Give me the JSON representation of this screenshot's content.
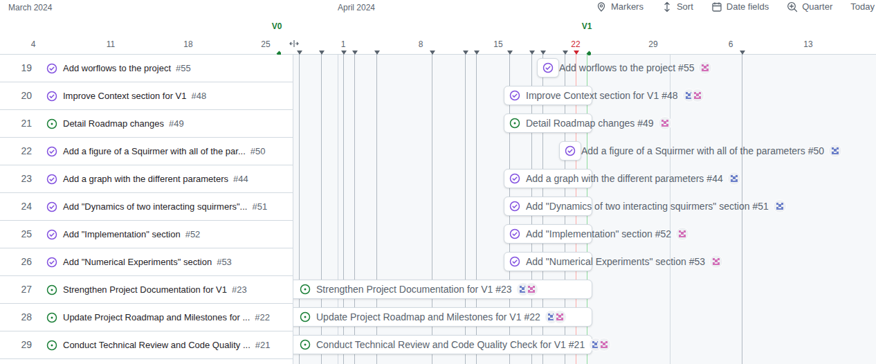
{
  "header": {
    "months": [
      {
        "label": "March 2024",
        "start": "2024-03-01"
      },
      {
        "label": "April 2024",
        "start": "2024-04-01"
      }
    ],
    "controls": [
      {
        "label": "Markers",
        "kind": "marker"
      },
      {
        "label": "Sort",
        "kind": "sort"
      },
      {
        "label": "Date fields",
        "kind": "calendar"
      },
      {
        "label": "Quarter",
        "kind": "zoom"
      },
      {
        "label": "Today",
        "kind": "none"
      }
    ],
    "ticks": [
      {
        "label": "4",
        "date": "2024-03-04",
        "today": false
      },
      {
        "label": "11",
        "date": "2024-03-11",
        "today": false
      },
      {
        "label": "18",
        "date": "2024-03-18",
        "today": false
      },
      {
        "label": "25",
        "date": "2024-03-25",
        "today": false
      },
      {
        "label": "1",
        "date": "2024-04-01",
        "today": false
      },
      {
        "label": "8",
        "date": "2024-04-08",
        "today": false
      },
      {
        "label": "15",
        "date": "2024-04-15",
        "today": false
      },
      {
        "label": "22",
        "date": "2024-04-22",
        "today": true
      },
      {
        "label": "29",
        "date": "2024-04-29",
        "today": false
      },
      {
        "label": "6",
        "date": "2024-05-06",
        "today": false
      },
      {
        "label": "13",
        "date": "2024-05-13",
        "today": false
      }
    ]
  },
  "markers": [
    {
      "date": "2024-03-26",
      "kind": "milestone",
      "label": "V0"
    },
    {
      "date": "2024-03-28",
      "kind": "date"
    },
    {
      "date": "2024-03-30",
      "kind": "date"
    },
    {
      "date": "2024-04-01",
      "kind": "date"
    },
    {
      "date": "2024-04-02",
      "kind": "date"
    },
    {
      "date": "2024-04-04",
      "kind": "date"
    },
    {
      "date": "2024-04-09",
      "kind": "date"
    },
    {
      "date": "2024-04-12",
      "kind": "date"
    },
    {
      "date": "2024-04-13",
      "kind": "date"
    },
    {
      "date": "2024-04-16",
      "kind": "date"
    },
    {
      "date": "2024-04-18",
      "kind": "date"
    },
    {
      "date": "2024-04-19",
      "kind": "date"
    },
    {
      "date": "2024-04-21",
      "kind": "date"
    },
    {
      "date": "2024-04-22",
      "kind": "today"
    },
    {
      "date": "2024-04-23",
      "kind": "milestone",
      "label": "V1"
    },
    {
      "date": "2024-05-07",
      "kind": "date"
    }
  ],
  "rows": [
    {
      "number": "19",
      "title": "Add worflows to the project",
      "issue": "#55",
      "bar_title": "Add worflows to the project",
      "state": "closed",
      "start": "2024-04-19",
      "end": "2024-04-20",
      "assignees": [
        {
          "color": "#d36fb8"
        }
      ]
    },
    {
      "number": "20",
      "title": "Improve Context section for V1",
      "issue": "#48",
      "bar_title": "Improve Context section for V1",
      "state": "closed",
      "start": "2024-04-16",
      "end": "2024-04-23",
      "assignees": [
        {
          "color": "#6b7fc9"
        },
        {
          "color": "#d36fb8"
        }
      ]
    },
    {
      "number": "21",
      "title": "Detail Roadmap changes",
      "issue": "#49",
      "bar_title": "Detail Roadmap changes",
      "state": "open",
      "start": "2024-04-16",
      "end": "2024-04-23",
      "assignees": [
        {
          "color": "#d36fb8"
        }
      ]
    },
    {
      "number": "22",
      "title": "Add a figure of a Squirmer with all of the par...",
      "issue": "#50",
      "bar_title": "Add a figure of a Squirmer with all of the parameters",
      "state": "closed",
      "start": "2024-04-21",
      "end": "2024-04-22",
      "assignees": [
        {
          "color": "#6b7fc9"
        }
      ]
    },
    {
      "number": "23",
      "title": "Add a graph with the different parameters",
      "issue": "#44",
      "bar_title": "Add a graph with the different parameters",
      "state": "closed",
      "start": "2024-04-16",
      "end": "2024-04-23",
      "assignees": [
        {
          "color": "#6b7fc9"
        }
      ]
    },
    {
      "number": "24",
      "title": "Add \"Dynamics of two interacting squirmers\"...",
      "issue": "#51",
      "bar_title": "Add \"Dynamics of two interacting squirmers\" section",
      "state": "closed",
      "start": "2024-04-16",
      "end": "2024-04-23",
      "assignees": [
        {
          "color": "#6b7fc9"
        }
      ]
    },
    {
      "number": "25",
      "title": "Add \"Implementation\" section",
      "issue": "#52",
      "bar_title": "Add \"Implementation\" section",
      "state": "closed",
      "start": "2024-04-16",
      "end": "2024-04-23",
      "assignees": [
        {
          "color": "#d36fb8"
        }
      ]
    },
    {
      "number": "26",
      "title": "Add \"Numerical Experiments\" section",
      "issue": "#53",
      "bar_title": "Add \"Numerical Experiments\" section",
      "state": "closed",
      "start": "2024-04-16",
      "end": "2024-04-23",
      "assignees": [
        {
          "color": "#d36fb8"
        }
      ]
    },
    {
      "number": "27",
      "title": "Strengthen Project Documentation for V1",
      "issue": "#23",
      "bar_title": "Strengthen Project Documentation for V1",
      "state": "open",
      "start": "2024-03-18",
      "end": "2024-04-23",
      "assignees": [
        {
          "color": "#6b7fc9"
        },
        {
          "color": "#d36fb8"
        }
      ]
    },
    {
      "number": "28",
      "title": "Update Project Roadmap and Milestones for ...",
      "issue": "#22",
      "bar_title": "Update Project Roadmap and Milestones for V1",
      "state": "open",
      "start": "2024-03-18",
      "end": "2024-04-23",
      "assignees": [
        {
          "color": "#6b7fc9"
        },
        {
          "color": "#d36fb8"
        }
      ]
    },
    {
      "number": "29",
      "title": "Conduct Technical Review and Code Quality ...",
      "issue": "#21",
      "bar_title": "Conduct Technical Review and Code Quality Check for V1",
      "state": "open",
      "start": "2024-03-18",
      "end": "2024-04-23",
      "assignees": [
        {
          "color": "#6b7fc9"
        },
        {
          "color": "#d36fb8"
        }
      ]
    }
  ]
}
